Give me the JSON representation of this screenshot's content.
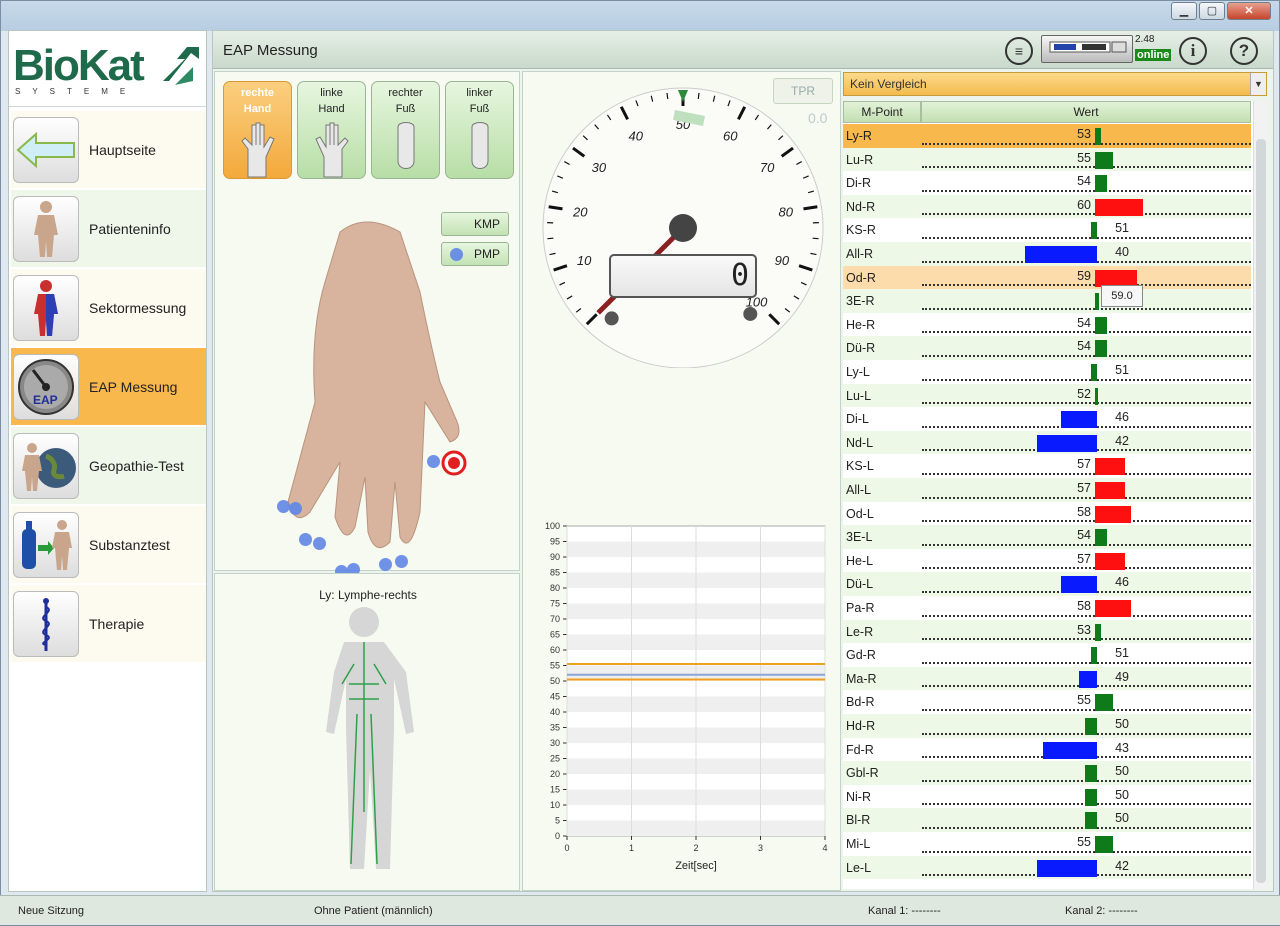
{
  "window": {
    "min_label": "▁",
    "max_label": "▢",
    "close_label": "✕"
  },
  "logo": {
    "title": "BioKat",
    "subtitle": "SYSTEME"
  },
  "nav": [
    {
      "label": "Hauptseite",
      "icon": "arrow-left-icon"
    },
    {
      "label": "Patienteninfo",
      "icon": "body-icon"
    },
    {
      "label": "Sektormessung",
      "icon": "sector-body-icon"
    },
    {
      "label": "EAP Messung",
      "icon": "eap-gauge-icon"
    },
    {
      "label": "Geopathie-Test",
      "icon": "globe-body-icon"
    },
    {
      "label": "Substanztest",
      "icon": "bottle-body-icon"
    },
    {
      "label": "Therapie",
      "icon": "caduceus-icon"
    }
  ],
  "header": {
    "title": "EAP Messung",
    "version": "2.48",
    "online": "online",
    "menu_icon": "≡",
    "info_icon": "i",
    "help_icon": "?"
  },
  "hand_buttons": [
    {
      "l1": "rechte",
      "l2": "Hand"
    },
    {
      "l1": "linke",
      "l2": "Hand"
    },
    {
      "l1": "rechter",
      "l2": "Fuß"
    },
    {
      "l1": "linker",
      "l2": "Fuß"
    }
  ],
  "kmp_label": "KMP",
  "pmp_label": "PMP",
  "body_caption": "Ly: Lymphe-rechts",
  "gauge": {
    "tpr_label": "TPR",
    "tpr_value": "0.0",
    "display": "0",
    "ticks": [
      "10",
      "20",
      "30",
      "40",
      "50",
      "60",
      "70",
      "80",
      "90",
      "100"
    ]
  },
  "chart_data": {
    "type": "line",
    "xlabel": "Zeit[sec]",
    "x_ticks": [
      "0",
      "1",
      "2",
      "3",
      "4"
    ],
    "y_ticks": [
      "0",
      "5",
      "10",
      "15",
      "20",
      "25",
      "30",
      "35",
      "40",
      "45",
      "50",
      "55",
      "60",
      "65",
      "70",
      "75",
      "80",
      "85",
      "90",
      "95",
      "100"
    ],
    "ylim": [
      0,
      100
    ],
    "xlim": [
      0,
      4
    ],
    "series": [
      {
        "values": [
          55.5,
          55.5
        ],
        "color": "#f0a020"
      },
      {
        "values": [
          50.5,
          50.5
        ],
        "color": "#f0a020"
      },
      {
        "values": [
          52,
          52
        ],
        "color": "#8aa6d8"
      }
    ]
  },
  "compare": {
    "selected": "Kein Vergleich"
  },
  "table": {
    "col_mpoint": "M-Point",
    "col_wert": "Wert",
    "tooltip": "59.0",
    "rows": [
      {
        "mp": "Ly-R",
        "v": 53
      },
      {
        "mp": "Lu-R",
        "v": 55
      },
      {
        "mp": "Di-R",
        "v": 54
      },
      {
        "mp": "Nd-R",
        "v": 60
      },
      {
        "mp": "KS-R",
        "v": 51
      },
      {
        "mp": "All-R",
        "v": 40
      },
      {
        "mp": "Od-R",
        "v": 59
      },
      {
        "mp": "3E-R",
        "v": ""
      },
      {
        "mp": "He-R",
        "v": 54
      },
      {
        "mp": "Dü-R",
        "v": 54
      },
      {
        "mp": "Ly-L",
        "v": 51
      },
      {
        "mp": "Lu-L",
        "v": 52
      },
      {
        "mp": "Di-L",
        "v": 46
      },
      {
        "mp": "Nd-L",
        "v": 42
      },
      {
        "mp": "KS-L",
        "v": 57
      },
      {
        "mp": "All-L",
        "v": 57
      },
      {
        "mp": "Od-L",
        "v": 58
      },
      {
        "mp": "3E-L",
        "v": 54
      },
      {
        "mp": "He-L",
        "v": 57
      },
      {
        "mp": "Dü-L",
        "v": 46
      },
      {
        "mp": "Pa-R",
        "v": 58
      },
      {
        "mp": "Le-R",
        "v": 53
      },
      {
        "mp": "Gd-R",
        "v": 51
      },
      {
        "mp": "Ma-R",
        "v": 49
      },
      {
        "mp": "Bd-R",
        "v": 55
      },
      {
        "mp": "Hd-R",
        "v": 50
      },
      {
        "mp": "Fd-R",
        "v": 43
      },
      {
        "mp": "Gbl-R",
        "v": 50
      },
      {
        "mp": "Ni-R",
        "v": 50
      },
      {
        "mp": "Bl-R",
        "v": 50
      },
      {
        "mp": "Mi-L",
        "v": 55
      },
      {
        "mp": "Le-L",
        "v": 42
      }
    ]
  },
  "status": {
    "session": "Neue Sitzung",
    "patient": "Ohne Patient (männlich)",
    "kanal1": "Kanal 1: --------",
    "kanal2": "Kanal 2: --------"
  }
}
